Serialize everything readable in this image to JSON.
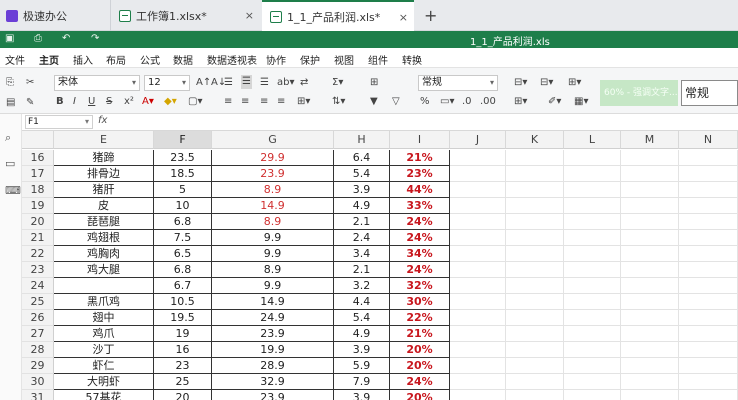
{
  "tabs": {
    "app": "极速办公",
    "wb1": "工作簿1.xlsx*",
    "wb2": "1_1_产品利润.xls*",
    "close": "×",
    "new": "+"
  },
  "window_title": "1_1_产品利润.xls",
  "menu": [
    "文件",
    "主页",
    "插入",
    "布局",
    "公式",
    "数据",
    "数据透视表",
    "协作",
    "保护",
    "视图",
    "组件",
    "转换"
  ],
  "active_menu": "主页",
  "ribbon": {
    "font_name": "宋体",
    "font_size": "12",
    "number_format": "常规",
    "style_preview": "60% - 强调文字...",
    "style_normal": "常规"
  },
  "formula_bar": {
    "cell_ref": "F1",
    "fx": "fx",
    "content": ""
  },
  "columns": [
    "E",
    "F",
    "G",
    "H",
    "I",
    "J",
    "K",
    "L",
    "M",
    "N"
  ],
  "active_column": "F",
  "rows": [
    {
      "n": "16",
      "E": "猪蹄",
      "F": "23.5",
      "G": "29.9",
      "H": "6.4",
      "I": "21%",
      "g_red": true
    },
    {
      "n": "17",
      "E": "排骨边",
      "F": "18.5",
      "G": "23.9",
      "H": "5.4",
      "I": "23%",
      "g_red": true
    },
    {
      "n": "18",
      "E": "猪肝",
      "F": "5",
      "G": "8.9",
      "H": "3.9",
      "I": "44%",
      "g_red": true
    },
    {
      "n": "19",
      "E": "皮",
      "F": "10",
      "G": "14.9",
      "H": "4.9",
      "I": "33%",
      "g_red": true
    },
    {
      "n": "20",
      "E": "琵琶腿",
      "F": "6.8",
      "G": "8.9",
      "H": "2.1",
      "I": "24%",
      "g_red": true
    },
    {
      "n": "21",
      "E": "鸡翅根",
      "F": "7.5",
      "G": "9.9",
      "H": "2.4",
      "I": "24%",
      "g_red": false
    },
    {
      "n": "22",
      "E": "鸡胸肉",
      "F": "6.5",
      "G": "9.9",
      "H": "3.4",
      "I": "34%",
      "g_red": false
    },
    {
      "n": "23",
      "E": "鸡大腿",
      "F": "6.8",
      "G": "8.9",
      "H": "2.1",
      "I": "24%",
      "g_red": false
    },
    {
      "n": "24",
      "E": "",
      "F": "6.7",
      "G": "9.9",
      "H": "3.2",
      "I": "32%",
      "g_red": false
    },
    {
      "n": "25",
      "E": "黑爪鸡",
      "F": "10.5",
      "G": "14.9",
      "H": "4.4",
      "I": "30%",
      "g_red": false
    },
    {
      "n": "26",
      "E": "翅中",
      "F": "19.5",
      "G": "24.9",
      "H": "5.4",
      "I": "22%",
      "g_red": false
    },
    {
      "n": "27",
      "E": "鸡爪",
      "F": "19",
      "G": "23.9",
      "H": "4.9",
      "I": "21%",
      "g_red": false
    },
    {
      "n": "28",
      "E": "沙丁",
      "F": "16",
      "G": "19.9",
      "H": "3.9",
      "I": "20%",
      "g_red": false
    },
    {
      "n": "29",
      "E": "虾仁",
      "F": "23",
      "G": "28.9",
      "H": "5.9",
      "I": "20%",
      "g_red": false
    },
    {
      "n": "30",
      "E": "大明虾",
      "F": "25",
      "G": "32.9",
      "H": "7.9",
      "I": "24%",
      "g_red": false
    },
    {
      "n": "31",
      "E": "57基花",
      "F": "20",
      "G": "23.9",
      "H": "3.9",
      "I": "20%",
      "g_red": false
    }
  ],
  "colors": {
    "accent": "#1e7e4a",
    "red_text": "#d03030",
    "percent_text": "#c8161d"
  }
}
